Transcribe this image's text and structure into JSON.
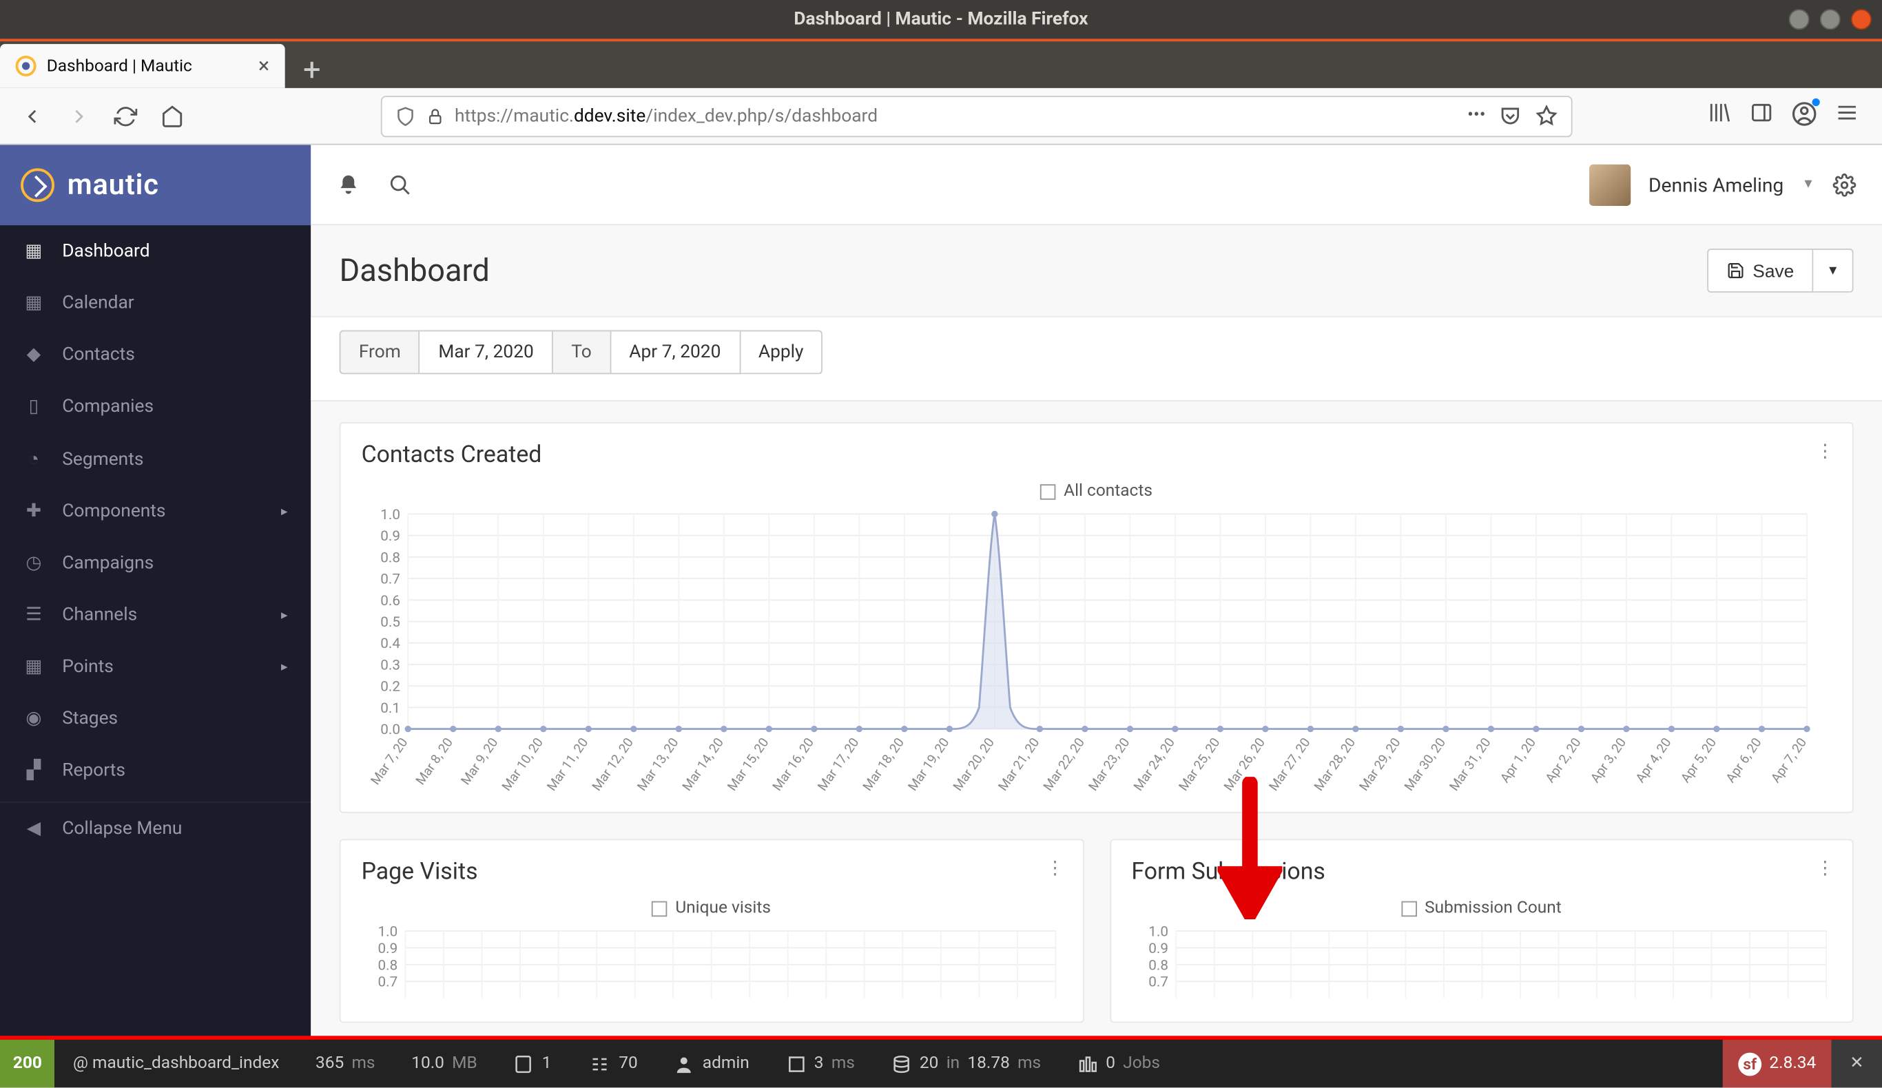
{
  "os": {
    "title": "Dashboard | Mautic - Mozilla Firefox"
  },
  "browser": {
    "tab_title": "Dashboard | Mautic",
    "url_proto": "https://",
    "url_host_pre": "mautic.",
    "url_host_main": "ddev.site",
    "url_path": "/index_dev.php/s/dashboard"
  },
  "sidebar": {
    "brand": "mautic",
    "items": [
      {
        "label": "Dashboard"
      },
      {
        "label": "Calendar"
      },
      {
        "label": "Contacts"
      },
      {
        "label": "Companies"
      },
      {
        "label": "Segments"
      },
      {
        "label": "Components"
      },
      {
        "label": "Campaigns"
      },
      {
        "label": "Channels"
      },
      {
        "label": "Points"
      },
      {
        "label": "Stages"
      },
      {
        "label": "Reports"
      }
    ],
    "collapse": "Collapse Menu"
  },
  "topbar": {
    "user": "Dennis Ameling"
  },
  "page": {
    "title": "Dashboard",
    "save": "Save",
    "from_label": "From",
    "from_value": "Mar 7, 2020",
    "to_label": "To",
    "to_value": "Apr 7, 2020",
    "apply": "Apply"
  },
  "panels": {
    "contacts": {
      "title": "Contacts Created",
      "legend": "All contacts"
    },
    "visits": {
      "title": "Page Visits",
      "legend": "Unique visits"
    },
    "forms": {
      "title": "Form Submissions",
      "legend": "Submission Count"
    }
  },
  "debug": {
    "status": "200",
    "route": "@ mautic_dashboard_index",
    "time": "365",
    "time_u": "ms",
    "mem": "10.0",
    "mem_u": "MB",
    "forms": "1",
    "twig": "70",
    "user": "admin",
    "db_t": "3",
    "db_u": "ms",
    "q_n": "20",
    "q_in": "in",
    "q_t": "18.78",
    "q_u": "ms",
    "jobs_n": "0",
    "jobs": "Jobs",
    "sf": "2.8.34"
  },
  "chart_data": [
    {
      "type": "line",
      "title": "Contacts Created",
      "legend": [
        "All contacts"
      ],
      "ylim": [
        0,
        1.0
      ],
      "yticks": [
        0,
        0.1,
        0.2,
        0.3,
        0.4,
        0.5,
        0.6,
        0.7,
        0.8,
        0.9,
        1.0
      ],
      "categories": [
        "Mar 7, 20",
        "Mar 8, 20",
        "Mar 9, 20",
        "Mar 10, 20",
        "Mar 11, 20",
        "Mar 12, 20",
        "Mar 13, 20",
        "Mar 14, 20",
        "Mar 15, 20",
        "Mar 16, 20",
        "Mar 17, 20",
        "Mar 18, 20",
        "Mar 19, 20",
        "Mar 20, 20",
        "Mar 21, 20",
        "Mar 22, 20",
        "Mar 23, 20",
        "Mar 24, 20",
        "Mar 25, 20",
        "Mar 26, 20",
        "Mar 27, 20",
        "Mar 28, 20",
        "Mar 29, 20",
        "Mar 30, 20",
        "Mar 31, 20",
        "Apr 1, 20",
        "Apr 2, 20",
        "Apr 3, 20",
        "Apr 4, 20",
        "Apr 5, 20",
        "Apr 6, 20",
        "Apr 7, 20"
      ],
      "values": [
        0,
        0,
        0,
        0,
        0,
        0,
        0,
        0,
        0,
        0,
        0,
        0,
        0,
        1,
        0,
        0,
        0,
        0,
        0,
        0,
        0,
        0,
        0,
        0,
        0,
        0,
        0,
        0,
        0,
        0,
        0,
        0
      ]
    },
    {
      "type": "line",
      "title": "Page Visits",
      "legend": [
        "Unique visits"
      ],
      "ylim": [
        0,
        1.0
      ],
      "yticks": [
        0.7,
        0.8,
        0.9,
        1.0
      ],
      "categories": [],
      "values": []
    },
    {
      "type": "line",
      "title": "Form Submissions",
      "legend": [
        "Submission Count"
      ],
      "ylim": [
        0,
        1.0
      ],
      "yticks": [
        0.7,
        0.8,
        0.9,
        1.0
      ],
      "categories": [],
      "values": []
    }
  ]
}
